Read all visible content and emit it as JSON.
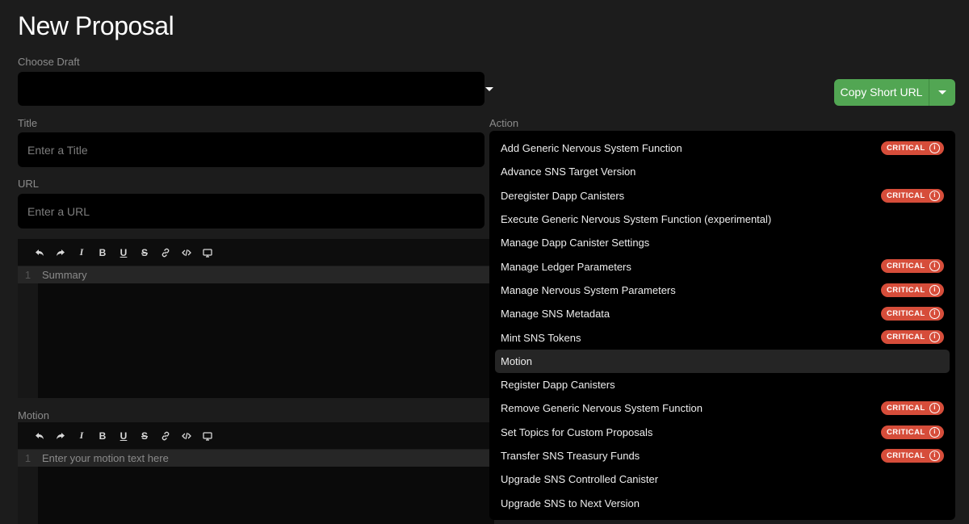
{
  "page": {
    "title": "New Proposal"
  },
  "draft": {
    "label": "Choose Draft",
    "value": ""
  },
  "copy_url": {
    "label": "Copy Short URL"
  },
  "title_field": {
    "label": "Title",
    "placeholder": "Enter a Title"
  },
  "url_field": {
    "label": "URL",
    "placeholder": "Enter a URL"
  },
  "summary_editor": {
    "line_number": "1",
    "placeholder": "Summary"
  },
  "motion_field": {
    "label": "Motion"
  },
  "motion_editor": {
    "line_number": "1",
    "placeholder": "Enter your motion text here"
  },
  "toolbar_icons": [
    "undo-icon",
    "redo-icon",
    "italic-icon",
    "bold-icon",
    "underline-icon",
    "strikethrough-icon",
    "link-icon",
    "code-icon",
    "preview-icon"
  ],
  "toolbar_glyphs": {
    "italic": "I",
    "bold": "B",
    "underline": "U",
    "strike": "S"
  },
  "action": {
    "label": "Action",
    "critical_label": "CRITICAL",
    "options": [
      {
        "label": "Add Generic Nervous System Function",
        "critical": true
      },
      {
        "label": "Advance SNS Target Version",
        "critical": false
      },
      {
        "label": "Deregister Dapp Canisters",
        "critical": true
      },
      {
        "label": "Execute Generic Nervous System Function (experimental)",
        "critical": false
      },
      {
        "label": "Manage Dapp Canister Settings",
        "critical": false
      },
      {
        "label": "Manage Ledger Parameters",
        "critical": true
      },
      {
        "label": "Manage Nervous System Parameters",
        "critical": true
      },
      {
        "label": "Manage SNS Metadata",
        "critical": true
      },
      {
        "label": "Mint SNS Tokens",
        "critical": true
      },
      {
        "label": "Motion",
        "critical": false,
        "highlighted": true
      },
      {
        "label": "Register Dapp Canisters",
        "critical": false
      },
      {
        "label": "Remove Generic Nervous System Function",
        "critical": true
      },
      {
        "label": "Set Topics for Custom Proposals",
        "critical": true
      },
      {
        "label": "Transfer SNS Treasury Funds",
        "critical": true
      },
      {
        "label": "Upgrade SNS Controlled Canister",
        "critical": false
      },
      {
        "label": "Upgrade SNS to Next Version",
        "critical": false
      }
    ]
  },
  "colors": {
    "accent_green": "#52a653",
    "critical_red": "#d64d3a",
    "background": "#1c1c1c"
  }
}
